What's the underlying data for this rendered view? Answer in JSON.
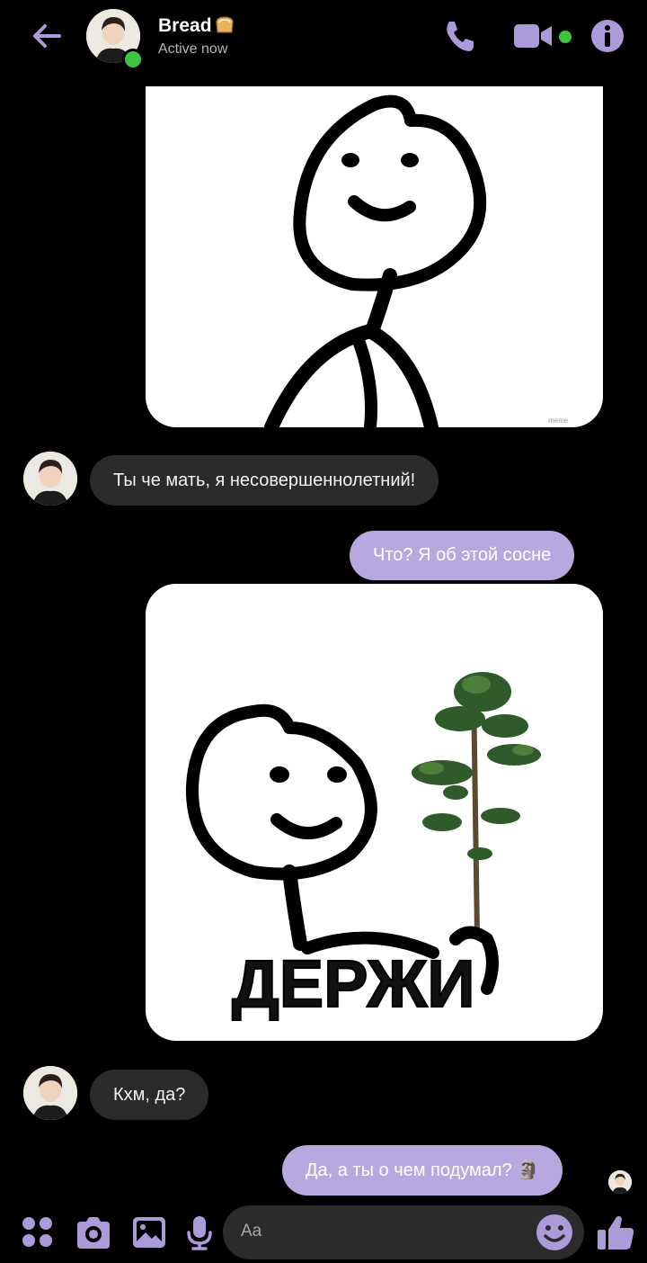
{
  "header": {
    "contact_name": "Bread",
    "status": "Active now",
    "icons": [
      "back-arrow-icon",
      "phone-icon",
      "video-camera-icon",
      "info-icon"
    ],
    "accent_color": "#ab9bd8",
    "online_color": "#3ec43e"
  },
  "messages": [
    {
      "type": "image",
      "from": "me",
      "caption": ""
    },
    {
      "type": "text",
      "from": "them",
      "text": "Ты че мать, я несовершеннолетний!"
    },
    {
      "type": "text",
      "from": "me",
      "text": "Что? Я об этой сосне"
    },
    {
      "type": "image",
      "from": "me",
      "caption": "ДЕРЖИ"
    },
    {
      "type": "text",
      "from": "them",
      "text": "Кхм, да?"
    },
    {
      "type": "text",
      "from": "me",
      "text": "Да, а ты о чем подумал? 🗿"
    }
  ],
  "composer": {
    "placeholder": "Aa",
    "icons": [
      "apps-icon",
      "camera-icon",
      "gallery-icon",
      "microphone-icon",
      "emoji-icon",
      "thumbs-up-icon"
    ]
  },
  "colors": {
    "incoming_bubble": "#2b2b2d",
    "outgoing_bubble": "#b8a8e0",
    "background": "#000000"
  }
}
